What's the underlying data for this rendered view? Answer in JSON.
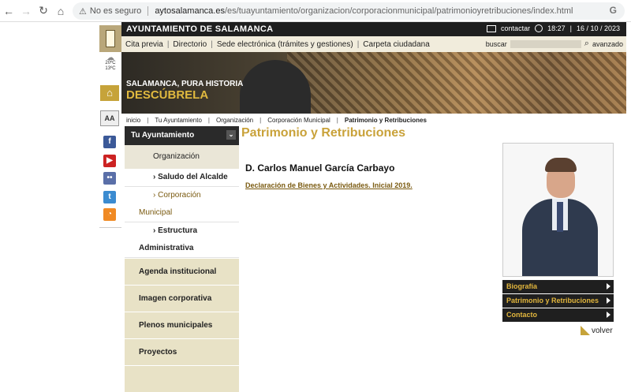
{
  "browser": {
    "warning": "No es seguro",
    "url_host": "aytosalamanca.es",
    "url_path": "/es/tuayuntamiento/organizacion/corporacionmunicipal/patrimonioyretribuciones/index.html"
  },
  "header": {
    "site_title": "AYUNTAMIENTO DE SALAMANCA",
    "contact": "contactar",
    "time": "18:27",
    "date": "16 / 10 / 2023",
    "date_sep": "|"
  },
  "menu": {
    "items": [
      "Cita previa",
      "Directorio",
      "Sede electrónica (trámites y gestiones)",
      "Carpeta ciudadana"
    ],
    "sep": "|",
    "search_label": "buscar",
    "advanced": "avanzado"
  },
  "weather": {
    "high": "20ºC",
    "low": "13ºC"
  },
  "rail": {
    "font_label": "AA"
  },
  "banner": {
    "line1": "SALAMANCA, PURA HISTORIA",
    "line2": "DESCÚBRELA"
  },
  "breadcrumb": {
    "items": [
      "inicio",
      "Tu Ayuntamiento",
      "Organización",
      "Corporación Municipal",
      "Patrimonio y Retribuciones"
    ],
    "sep": "|"
  },
  "sidebar": {
    "header": "Tu Ayuntamiento",
    "org": "Organización",
    "sub1": "› Saludo del Alcalde",
    "sub2a": "› Corporación",
    "sub2b": "Municipal",
    "sub3a": "› Estructura",
    "sub3b": "Administrativa",
    "blocks": [
      "Agenda institucional",
      "Imagen corporativa",
      "Plenos municipales",
      "Proyectos"
    ]
  },
  "main": {
    "title": "Patrimonio y Retribuciones",
    "name": "D. Carlos Manuel García Carbayo",
    "link": "Declaración de Bienes y Actividades. Inicial 2019."
  },
  "right_menu": [
    "Biografía",
    "Patrimonio y Retribuciones",
    "Contacto"
  ],
  "back": "volver"
}
